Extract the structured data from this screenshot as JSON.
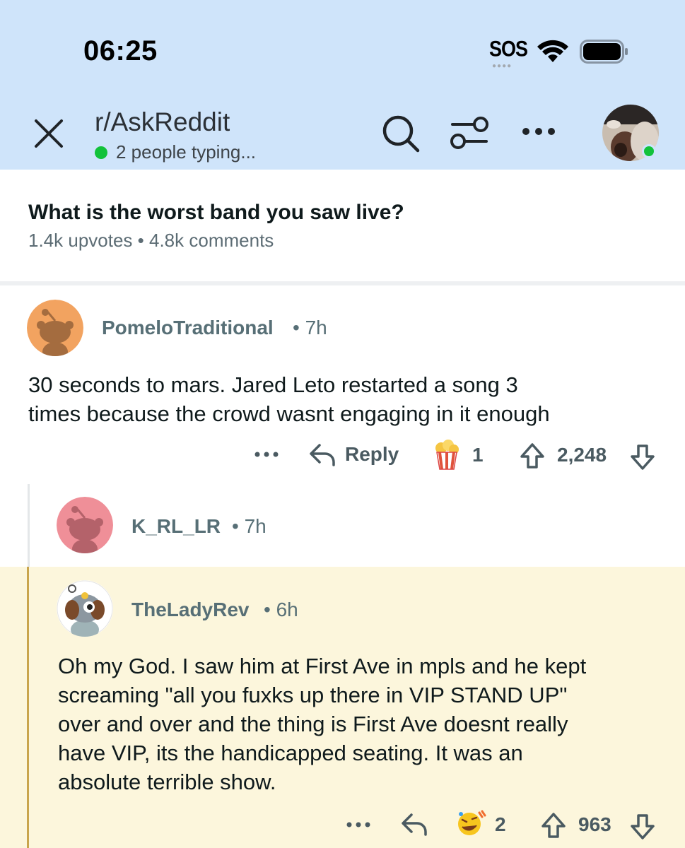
{
  "status_bar": {
    "time": "06:25",
    "sos": "SOS"
  },
  "header": {
    "subreddit": "r/AskReddit",
    "typing": "2 people typing..."
  },
  "post": {
    "title": "What is the worst band you saw live?",
    "upvotes": "1.4k upvotes",
    "comments": "4.8k comments"
  },
  "comments": [
    {
      "username": "PomeloTraditional",
      "time": "7h",
      "body_lines": [
        "30 seconds to mars. Jared Leto restarted a song 3",
        "times because the crowd wasnt engaging in it enough"
      ],
      "reply_label": "Reply",
      "award_count": "1",
      "score": "2,248",
      "avatar_color": "#f2a360"
    },
    {
      "username": "K_RL_LR",
      "time": "7h",
      "avatar_color": "#ef8f98"
    },
    {
      "username": "TheLadyRev",
      "time": "6h",
      "body_lines": [
        "Oh my God. I saw him at First Ave in mpls and he kept",
        "screaming \"all you fuxks up there in VIP STAND UP\"",
        "over and over and the thing is First Ave doesnt really",
        "have VIP, its the handicapped seating. It was an",
        "absolute terrible show."
      ],
      "award_count": "2",
      "score": "963"
    }
  ],
  "colors": {
    "header_bg": "#cfe4fa",
    "online_green": "#12c23a",
    "highlight_bg": "#fcf6dc",
    "highlight_bar": "#c9a54d"
  },
  "icons": [
    "close-icon",
    "search-icon",
    "filter-icon",
    "more-icon",
    "wifi-icon",
    "battery-icon",
    "reply-icon",
    "upvote-icon",
    "downvote-icon",
    "popcorn-award-icon",
    "laugh-award-icon"
  ]
}
